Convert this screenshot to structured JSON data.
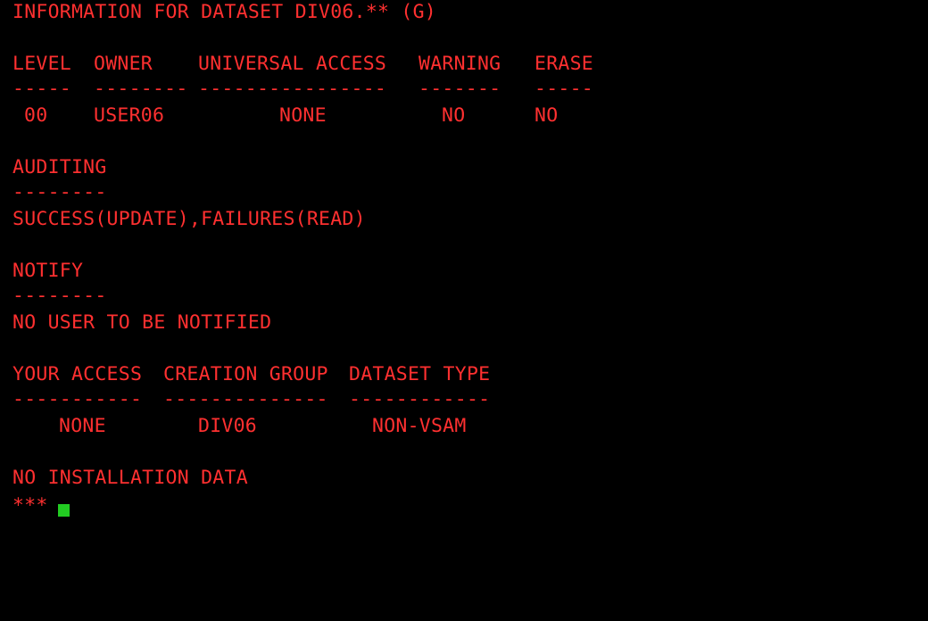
{
  "colors": {
    "background": "#000000",
    "text": "#ff3030",
    "cursor": "#22cc22"
  },
  "terminal": {
    "title": "INFORMATION FOR DATASET DIV06.** (G)",
    "general": {
      "headers": [
        "LEVEL",
        "OWNER",
        "UNIVERSAL ACCESS",
        "WARNING",
        "ERASE"
      ],
      "underlines": [
        "-----",
        "--------",
        "----------------",
        "-------",
        "-----"
      ],
      "row": {
        "level": "00",
        "owner": "USER06",
        "universal_access": "NONE",
        "warning": "NO",
        "erase": "NO"
      }
    },
    "auditing": {
      "heading": "AUDITING",
      "underline": "--------",
      "value": "SUCCESS(UPDATE),FAILURES(READ)"
    },
    "notify": {
      "heading": "NOTIFY",
      "underline": "--------",
      "value": "NO USER TO BE NOTIFIED"
    },
    "access": {
      "headers": [
        "YOUR ACCESS",
        "CREATION GROUP",
        "DATASET TYPE"
      ],
      "underlines": [
        "-----------",
        "--------------",
        "------------"
      ],
      "row": {
        "your_access": "NONE",
        "creation_group": "DIV06",
        "dataset_type": "NON-VSAM"
      }
    },
    "installation_data": "NO INSTALLATION DATA",
    "prompt": "***"
  }
}
